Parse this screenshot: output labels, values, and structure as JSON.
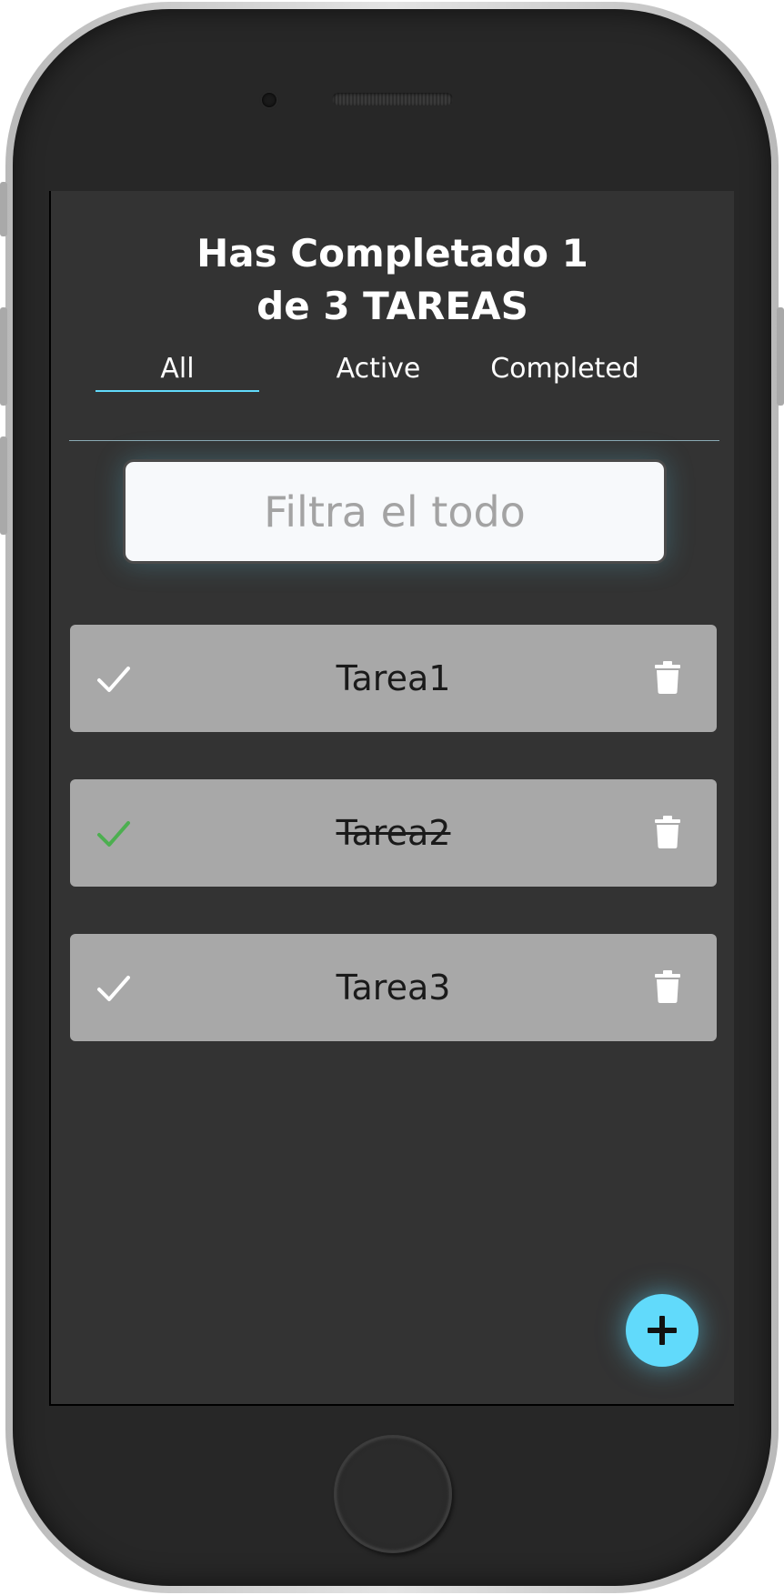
{
  "header": {
    "title_line1": "Has Completado 1",
    "title_line2": "de 3 TAREAS"
  },
  "tabs": [
    {
      "label": "All",
      "active": true
    },
    {
      "label": "Active",
      "active": false
    },
    {
      "label": "Completed",
      "active": false
    }
  ],
  "filter": {
    "placeholder": "Filtra el todo",
    "value": ""
  },
  "todos": [
    {
      "text": "Tarea1",
      "completed": false
    },
    {
      "text": "Tarea2",
      "completed": true
    },
    {
      "text": "Tarea3",
      "completed": false
    }
  ],
  "colors": {
    "accent": "#61dafb",
    "check_done": "#4caf50",
    "check_default": "#ffffff",
    "screen_bg": "#333333",
    "todo_bg": "#a8a8a8"
  },
  "icons": {
    "check": "check-icon",
    "trash": "trash-icon",
    "add": "plus-icon"
  }
}
